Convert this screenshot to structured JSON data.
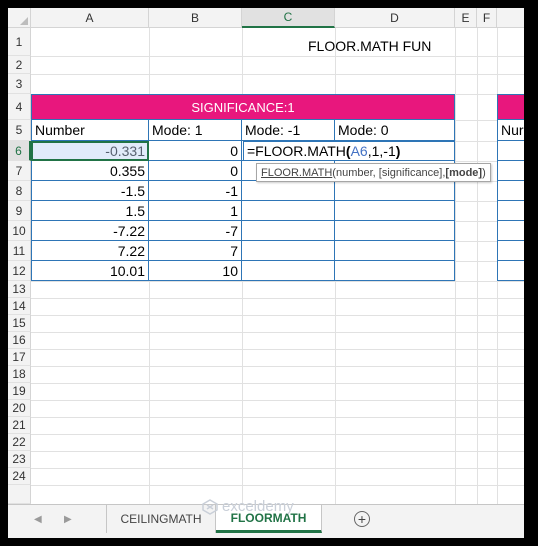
{
  "columns": [
    "A",
    "B",
    "C",
    "D",
    "E",
    "F"
  ],
  "selected_column": "C",
  "rows": [
    "1",
    "2",
    "3",
    "4",
    "5",
    "6",
    "7",
    "8",
    "9",
    "10",
    "11",
    "12",
    "13",
    "14",
    "15",
    "16",
    "17",
    "18",
    "19",
    "20",
    "21",
    "22",
    "23",
    "24"
  ],
  "selected_row": "6",
  "sheet_title": "FLOOR.MATH FUN",
  "table": {
    "banner": "SIGNIFICANCE:1",
    "headers": [
      "Number",
      "Mode: 1",
      "Mode: -1",
      "Mode: 0"
    ],
    "data": [
      {
        "number": "-0.331",
        "mode1": "0",
        "modeneg1": "",
        "mode0": ""
      },
      {
        "number": "0.355",
        "mode1": "0",
        "modeneg1": "",
        "mode0": ""
      },
      {
        "number": "-1.5",
        "mode1": "-1",
        "modeneg1": "",
        "mode0": ""
      },
      {
        "number": "1.5",
        "mode1": "1",
        "modeneg1": "",
        "mode0": ""
      },
      {
        "number": "-7.22",
        "mode1": "-7",
        "modeneg1": "",
        "mode0": ""
      },
      {
        "number": "7.22",
        "mode1": "7",
        "modeneg1": "",
        "mode0": ""
      },
      {
        "number": "10.01",
        "mode1": "10",
        "modeneg1": "",
        "mode0": ""
      }
    ]
  },
  "second_table": {
    "header_partial": "Nur"
  },
  "formula_edit": {
    "prefix": "=FLOOR.MATH",
    "open_paren": "(",
    "ref": "A6",
    "args": ",1,-1",
    "close_paren": ")"
  },
  "tooltip": {
    "fn": "FLOOR.MATH",
    "args": "(number, [significance], ",
    "current": "[mode]",
    "close": ")"
  },
  "tabs": [
    {
      "label": "CEILINGMATH",
      "active": false
    },
    {
      "label": "FLOORMATH",
      "active": true
    }
  ],
  "watermark": "exceldemy",
  "colors": {
    "banner": "#e8177d",
    "table_border": "#2e75b6",
    "excel_green": "#217346",
    "reference_blue": "#4472c4"
  }
}
